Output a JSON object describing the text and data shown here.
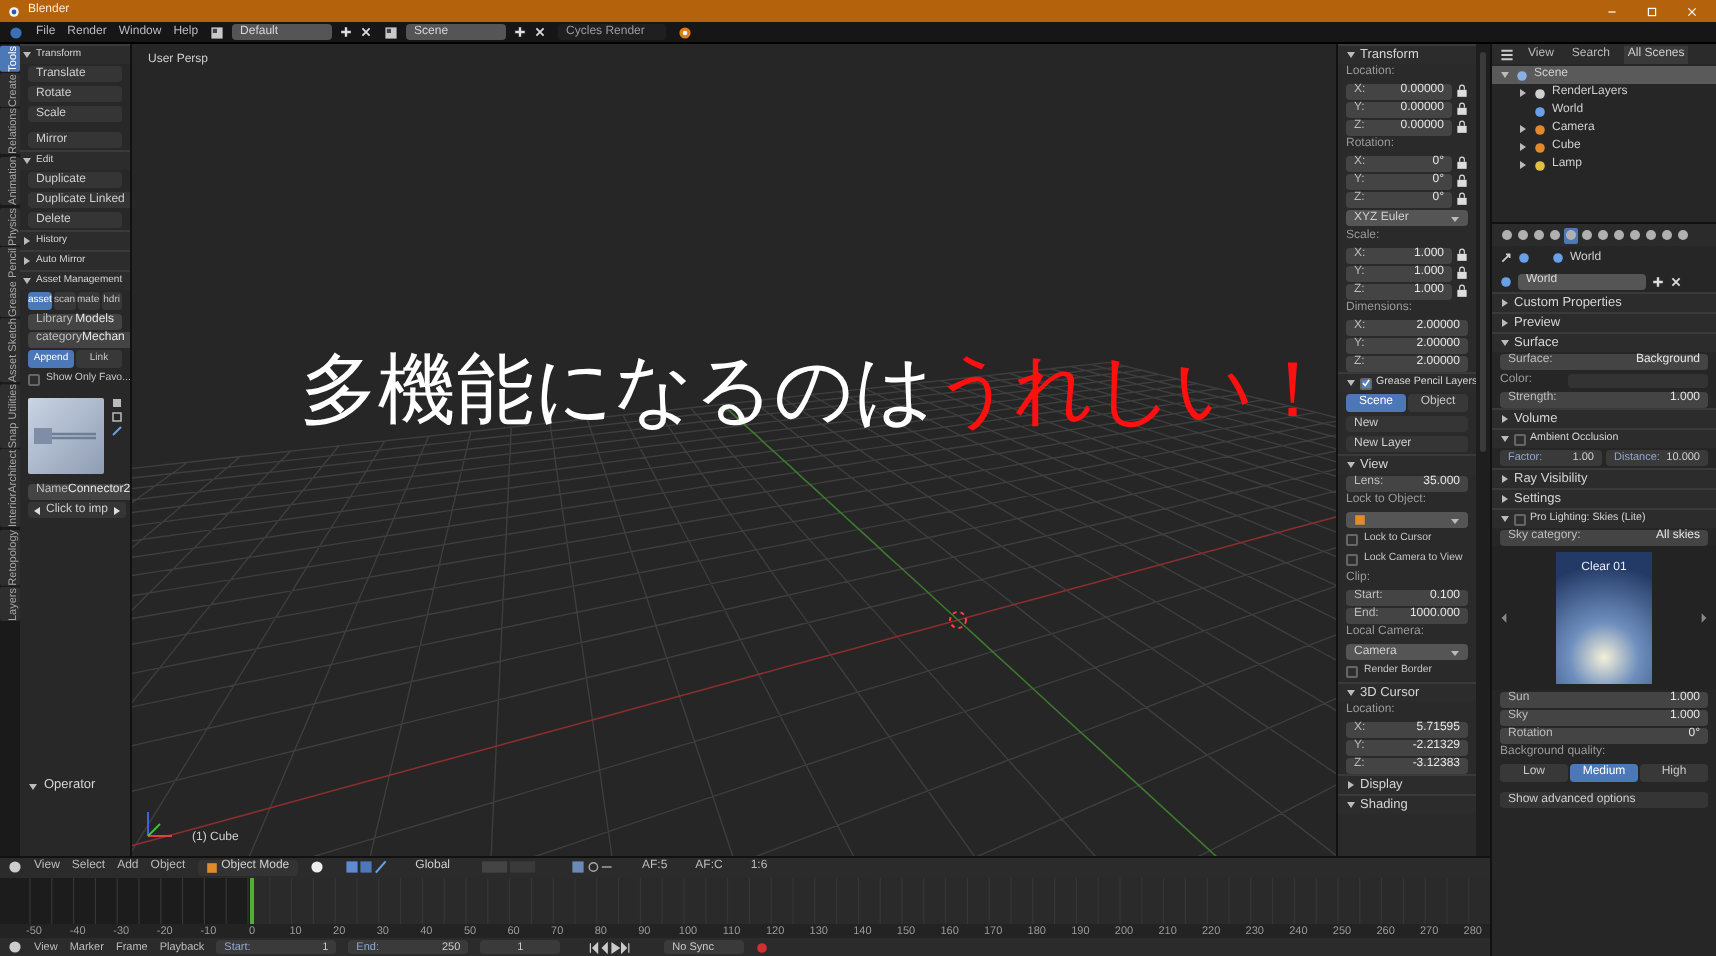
{
  "window": {
    "title": "Blender"
  },
  "menu": [
    "File",
    "Render",
    "Window",
    "Help"
  ],
  "layout_field": "Default",
  "scene_field": "Scene",
  "engine": "Cycles Render",
  "left_tabs": [
    {
      "label": "Tools",
      "selected": true
    },
    {
      "label": "Create",
      "selected": false
    },
    {
      "label": "Relations",
      "selected": false
    },
    {
      "label": "Animation",
      "selected": false
    },
    {
      "label": "Physics",
      "selected": false
    },
    {
      "label": "Grease Pencil",
      "selected": false
    },
    {
      "label": "Asset Sketch",
      "selected": false
    },
    {
      "label": "Snap Utilities",
      "selected": false
    },
    {
      "label": "InteriorArchitect",
      "selected": false
    },
    {
      "label": "Retopology",
      "selected": false
    },
    {
      "label": "Layers",
      "selected": false
    }
  ],
  "toolbar": [
    {
      "kind": "header",
      "label": "Transform",
      "expanded": true
    },
    {
      "kind": "button",
      "label": "Translate"
    },
    {
      "kind": "button",
      "label": "Rotate"
    },
    {
      "kind": "button",
      "label": "Scale"
    },
    {
      "kind": "gap"
    },
    {
      "kind": "button",
      "label": "Mirror"
    },
    {
      "kind": "header",
      "label": "Edit",
      "expanded": true
    },
    {
      "kind": "button",
      "label": "Duplicate"
    },
    {
      "kind": "button",
      "label": "Duplicate Linked"
    },
    {
      "kind": "button",
      "label": "Delete"
    },
    {
      "kind": "header",
      "label": "History",
      "expanded": false
    },
    {
      "kind": "header",
      "label": "Auto Mirror",
      "expanded": false
    },
    {
      "kind": "header",
      "label": "Asset Management",
      "expanded": true
    },
    {
      "kind": "buttons",
      "items": [
        {
          "label": "asset",
          "selected": true
        },
        {
          "label": "scan",
          "selected": false
        },
        {
          "label": "mate",
          "selected": false
        },
        {
          "label": "hdri",
          "selected": false
        }
      ]
    },
    {
      "kind": "field",
      "label": "Library",
      "value": "Models"
    },
    {
      "kind": "field",
      "label": "category",
      "value": "Mechan"
    },
    {
      "kind": "buttons",
      "items": [
        {
          "label": "Append",
          "selected": true
        },
        {
          "label": "Link",
          "selected": false
        }
      ]
    },
    {
      "kind": "check",
      "label": "Show Only Favo...",
      "checked": false
    },
    {
      "kind": "photo"
    },
    {
      "kind": "field",
      "label": "Name",
      "value": "Connector2"
    },
    {
      "kind": "nav",
      "label": "Click to imp"
    }
  ],
  "operator": {
    "label": "Operator",
    "expanded": true
  },
  "viewport": {
    "view_name": "User Persp",
    "object_label": "(1) Cube"
  },
  "caption": [
    {
      "text": "多機能になるのは",
      "color": "#ffffff"
    },
    {
      "text": "うれしい！",
      "color": "#ff1010"
    }
  ],
  "n_panel": [
    {
      "kind": "header",
      "label": "Transform",
      "expanded": true
    },
    {
      "kind": "label",
      "text": "Location:"
    },
    {
      "kind": "field",
      "label": "X:",
      "value": "0.00000",
      "lock": true
    },
    {
      "kind": "field",
      "label": "Y:",
      "value": "0.00000",
      "lock": true
    },
    {
      "kind": "field",
      "label": "Z:",
      "value": "0.00000",
      "lock": true
    },
    {
      "kind": "label",
      "text": "Rotation:"
    },
    {
      "kind": "field",
      "label": "X:",
      "value": "0°",
      "lock": true
    },
    {
      "kind": "field",
      "label": "Y:",
      "value": "0°",
      "lock": true
    },
    {
      "kind": "field",
      "label": "Z:",
      "value": "0°",
      "lock": true
    },
    {
      "kind": "dropdown",
      "value": "XYZ Euler"
    },
    {
      "kind": "label",
      "text": "Scale:"
    },
    {
      "kind": "field",
      "label": "X:",
      "value": "1.000",
      "lock": true
    },
    {
      "kind": "field",
      "label": "Y:",
      "value": "1.000",
      "lock": true
    },
    {
      "kind": "field",
      "label": "Z:",
      "value": "1.000",
      "lock": true
    },
    {
      "kind": "label",
      "text": "Dimensions:"
    },
    {
      "kind": "field",
      "label": "X:",
      "value": "2.00000"
    },
    {
      "kind": "field",
      "label": "Y:",
      "value": "2.00000"
    },
    {
      "kind": "field",
      "label": "Z:",
      "value": "2.00000"
    },
    {
      "kind": "header",
      "label": "Grease Pencil Layers",
      "expanded": true,
      "checked": true
    },
    {
      "kind": "buttons",
      "items": [
        {
          "label": "Scene",
          "selected": true
        },
        {
          "label": "Object",
          "selected": false
        }
      ]
    },
    {
      "kind": "button",
      "label": "New"
    },
    {
      "kind": "button",
      "label": "New Layer"
    },
    {
      "kind": "header",
      "label": "View",
      "expanded": true
    },
    {
      "kind": "field",
      "label": "Lens:",
      "value": "35.000"
    },
    {
      "kind": "label",
      "text": "Lock to Object:"
    },
    {
      "kind": "dropdown"
    },
    {
      "kind": "check",
      "label": "Lock to Cursor",
      "checked": false
    },
    {
      "kind": "check",
      "label": "Lock Camera to View",
      "checked": false
    },
    {
      "kind": "label",
      "text": "Clip:"
    },
    {
      "kind": "field",
      "label": "Start:",
      "value": "0.100"
    },
    {
      "kind": "field",
      "label": "End:",
      "value": "1000.000"
    },
    {
      "kind": "label",
      "text": "Local Camera:"
    },
    {
      "kind": "dropdown",
      "value": "Camera"
    },
    {
      "kind": "check",
      "label": "Render Border",
      "checked": false
    },
    {
      "kind": "header",
      "label": "3D Cursor",
      "expanded": true
    },
    {
      "kind": "label",
      "text": "Location:"
    },
    {
      "kind": "field",
      "label": "X:",
      "value": "5.71595"
    },
    {
      "kind": "field",
      "label": "Y:",
      "value": "-2.21329"
    },
    {
      "kind": "field",
      "label": "Z:",
      "value": "-3.12383"
    },
    {
      "kind": "header",
      "label": "Display",
      "expanded": false
    },
    {
      "kind": "header",
      "label": "Shading",
      "expanded": true
    }
  ],
  "outliner": {
    "header": [
      "View",
      "Search",
      "All Scenes"
    ],
    "tree": [
      {
        "label": "Scene",
        "expanded": true,
        "selected": true,
        "children": [
          {
            "label": "RenderLayers",
            "expanded": false,
            "selected": false
          },
          {
            "label": "World",
            "selected": false
          },
          {
            "label": "Camera",
            "expanded": false,
            "selected": false
          },
          {
            "label": "Cube",
            "expanded": false,
            "selected": false
          },
          {
            "label": "Lamp",
            "expanded": false,
            "selected": false
          }
        ]
      }
    ]
  },
  "prop_tabs": [
    {
      "selected": false
    },
    {
      "selected": false
    },
    {
      "selected": false
    },
    {
      "selected": false
    },
    {
      "selected": true
    },
    {
      "selected": false
    },
    {
      "selected": false
    },
    {
      "selected": false
    },
    {
      "selected": false
    },
    {
      "selected": false
    },
    {
      "selected": false
    },
    {
      "selected": false
    }
  ],
  "breadcrumb": "World",
  "datablock": "World",
  "properties": [
    {
      "kind": "header",
      "label": "Custom Properties",
      "expanded": false
    },
    {
      "kind": "header",
      "label": "Preview",
      "expanded": false
    },
    {
      "kind": "header",
      "label": "Surface",
      "expanded": true
    },
    {
      "kind": "field",
      "label": "Surface:",
      "value": "Background"
    },
    {
      "kind": "color",
      "label": "Color:"
    },
    {
      "kind": "field",
      "label": "Strength:",
      "value": "1.000"
    },
    {
      "kind": "header",
      "label": "Volume",
      "expanded": false
    },
    {
      "kind": "header",
      "label": "Ambient Occlusion",
      "expanded": true,
      "checked": false
    },
    {
      "kind": "pair",
      "items": [
        {
          "label": "Factor:",
          "value": "1.00"
        },
        {
          "label": "Distance:",
          "value": "10.000"
        }
      ]
    },
    {
      "kind": "header",
      "label": "Ray Visibility",
      "expanded": false
    },
    {
      "kind": "header",
      "label": "Settings",
      "expanded": false
    },
    {
      "kind": "header",
      "label": "Pro Lighting: Skies (Lite)",
      "expanded": true,
      "checked": false
    },
    {
      "kind": "field",
      "label": "Sky category:",
      "value": "All skies"
    },
    {
      "kind": "sky",
      "caption": "Clear 01"
    },
    {
      "kind": "field",
      "label": "Sun",
      "value": "1.000"
    },
    {
      "kind": "field",
      "label": "Sky",
      "value": "1.000"
    },
    {
      "kind": "field",
      "label": "Rotation",
      "value": "0°"
    },
    {
      "kind": "label",
      "text": "Background quality:"
    },
    {
      "kind": "buttons",
      "items": [
        {
          "label": "Low",
          "selected": false
        },
        {
          "label": "Medium",
          "selected": true
        },
        {
          "label": "High",
          "selected": false
        }
      ]
    },
    {
      "kind": "gap"
    },
    {
      "kind": "button",
      "label": "Show advanced options"
    }
  ],
  "view_header": {
    "menus": [
      "View",
      "Select",
      "Add",
      "Object"
    ],
    "mode": "Object Mode",
    "orientation": "Global",
    "extras": [
      "AF:5",
      "AF:C",
      "1:6"
    ]
  },
  "timeline": {
    "ticks": [
      "-50",
      "-40",
      "-30",
      "-20",
      "-10",
      "0",
      "10",
      "20",
      "30",
      "40",
      "50",
      "60",
      "70",
      "80",
      "90",
      "100",
      "110",
      "120",
      "130",
      "140",
      "150",
      "160",
      "170",
      "180",
      "190",
      "200",
      "210",
      "220",
      "230",
      "240",
      "250",
      "260",
      "270",
      "280"
    ],
    "menus": [
      "View",
      "Marker",
      "Frame",
      "Playback"
    ],
    "start": {
      "label": "Start:",
      "value": "1"
    },
    "end": {
      "label": "End:",
      "value": "250"
    },
    "frame": "1",
    "sync": "No Sync"
  }
}
